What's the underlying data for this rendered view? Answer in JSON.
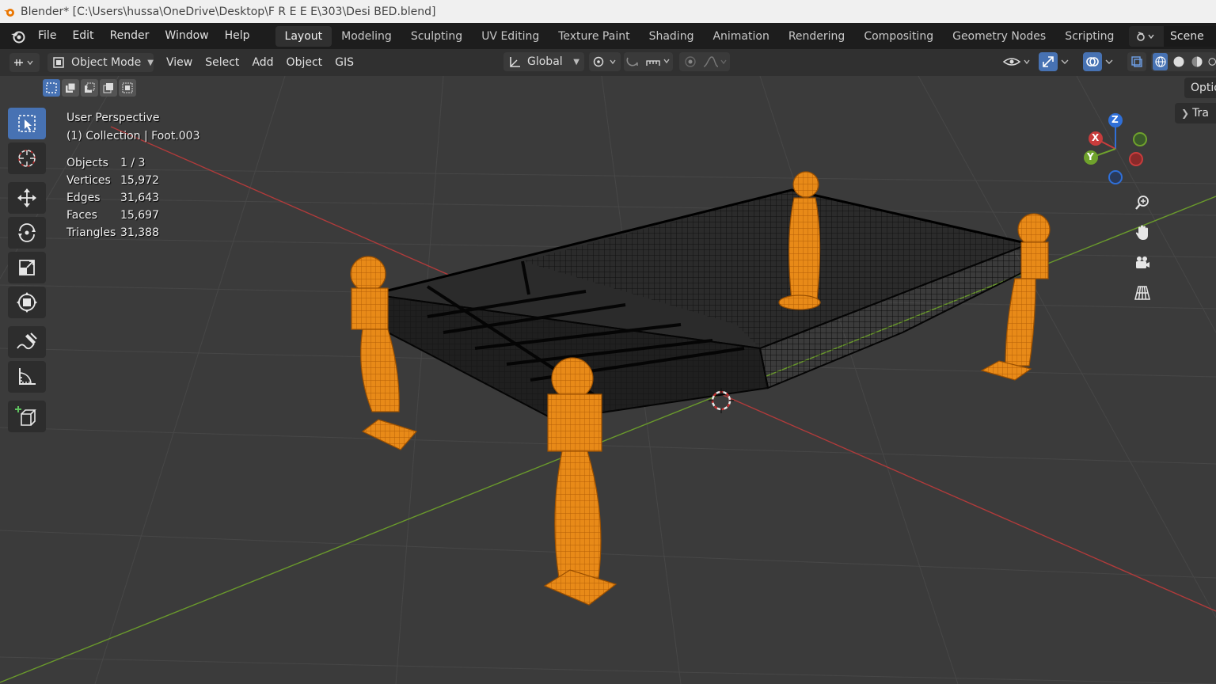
{
  "window": {
    "title": "Blender* [C:\\Users\\hussa\\OneDrive\\Desktop\\F R E E E\\303\\Desi BED.blend]"
  },
  "menu": {
    "items": [
      "File",
      "Edit",
      "Render",
      "Window",
      "Help"
    ]
  },
  "workspaces": {
    "tabs": [
      "Layout",
      "Modeling",
      "Sculpting",
      "UV Editing",
      "Texture Paint",
      "Shading",
      "Animation",
      "Rendering",
      "Compositing",
      "Geometry Nodes",
      "Scripting"
    ],
    "active": "Layout",
    "add_label": "+"
  },
  "scene": {
    "name": "Scene"
  },
  "header": {
    "mode": "Object Mode",
    "menus": [
      "View",
      "Select",
      "Add",
      "Object",
      "GIS"
    ],
    "orientation": "Global"
  },
  "viewport": {
    "perspective": "User Perspective",
    "context": "(1) Collection | Foot.003",
    "stats": [
      {
        "label": "Objects",
        "value": "1 / 3"
      },
      {
        "label": "Vertices",
        "value": "15,972"
      },
      {
        "label": "Edges",
        "value": "31,643"
      },
      {
        "label": "Faces",
        "value": "15,697"
      },
      {
        "label": "Triangles",
        "value": "31,388"
      }
    ],
    "sidebar_tabs": {
      "options": "Optio",
      "transform": "Tra"
    }
  },
  "gizmo": {
    "x": "X",
    "y": "Y",
    "z": "Z"
  },
  "colors": {
    "accent": "#4772b3",
    "selected_orange": "#f2941c",
    "axis_x": "#c83c3c",
    "axis_y": "#6fa22c",
    "axis_z": "#2f6fd8",
    "viewport_bg": "#3b3b3b"
  }
}
